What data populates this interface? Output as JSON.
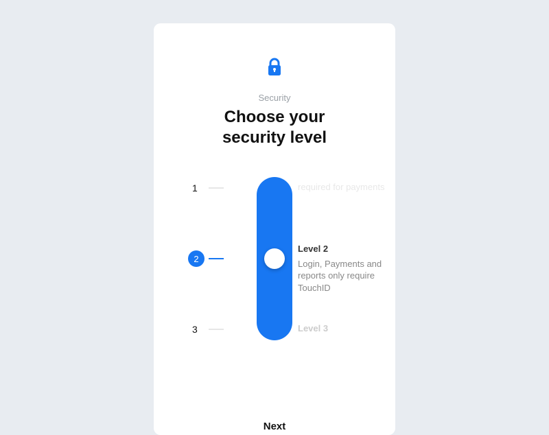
{
  "header": {
    "eyebrow": "Security",
    "title_line1": "Choose your",
    "title_line2": "security level"
  },
  "levels": {
    "l1": {
      "num": "1"
    },
    "l2": {
      "num": "2"
    },
    "l3": {
      "num": "3"
    }
  },
  "descriptions": {
    "d1": {
      "body": "required for payments"
    },
    "d2": {
      "title": "Level 2",
      "body": "Login, Payments and reports only require TouchID"
    },
    "d3": {
      "title": "Level 3"
    }
  },
  "actions": {
    "next": "Next"
  },
  "colors": {
    "accent": "#1877f2"
  }
}
